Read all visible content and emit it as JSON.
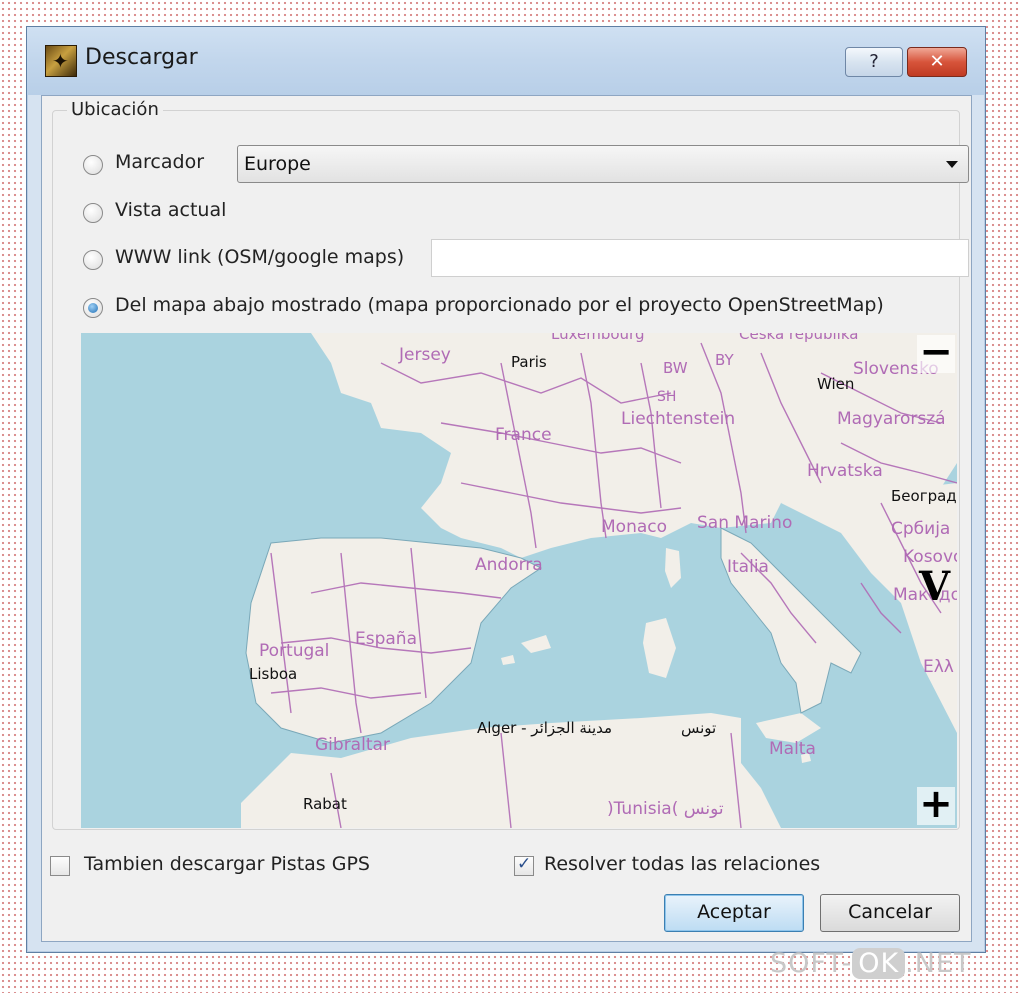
{
  "window": {
    "title": "Descargar",
    "help_label": "?",
    "close_label": "✕"
  },
  "location": {
    "group_label": "Ubicación",
    "options": {
      "bookmark": "Marcador",
      "current_view": "Vista actual",
      "www_link": "WWW link (OSM/google maps)",
      "from_map": "Del mapa abajo mostrado (mapa proporcionado por el proyecto OpenStreetMap)"
    },
    "bookmark_value": "Europe",
    "www_link_value": "",
    "selected": "from_map"
  },
  "map": {
    "countries": {
      "jersey": "Jersey",
      "france": "France",
      "monaco": "Monaco",
      "san_marino": "San Marino",
      "andorra": "Andorra",
      "espana": "España",
      "portugal": "Portugal",
      "italia": "Italia",
      "gibraltar": "Gibraltar",
      "malta": "Malta",
      "tunisia": ")Tunisia( تونس",
      "liechtenstein": "Liechtenstein",
      "hrvatska": "Hrvatska",
      "magyarorszag": "Magyarorszá",
      "slovensko": "Slovensko",
      "srbija": "Србија",
      "kosovo": "Kosovo",
      "makedonija": "Македо",
      "ellada": "Ελλ",
      "luxembourg": "Luxembourg",
      "ceska": "Česká republika",
      "bw": "BW",
      "by": "BY",
      "sh": "SH"
    },
    "cities": {
      "paris": "Paris",
      "wien": "Wien",
      "beograd": "Београд",
      "lisboa": "Lisboa",
      "alger": "Alger - مدينة الجزائر",
      "tunis": "تونس",
      "rabat": "Rabat"
    },
    "zoom_out": "−",
    "zoom_in": "+",
    "marker_letter": "V"
  },
  "options": {
    "gps_tracks": "Tambien descargar Pistas GPS",
    "gps_tracks_checked": false,
    "resolve_relations": "Resolver todas las relaciones",
    "resolve_relations_checked": true
  },
  "buttons": {
    "ok": "Aceptar",
    "cancel": "Cancelar"
  },
  "watermark": {
    "prefix": "SOFT-",
    "box": "OK",
    "suffix": ".NET"
  },
  "colors": {
    "sea": "#aad3df",
    "land": "#f2efe9",
    "border": "#b06bb5",
    "accent": "#3c7fb1"
  }
}
